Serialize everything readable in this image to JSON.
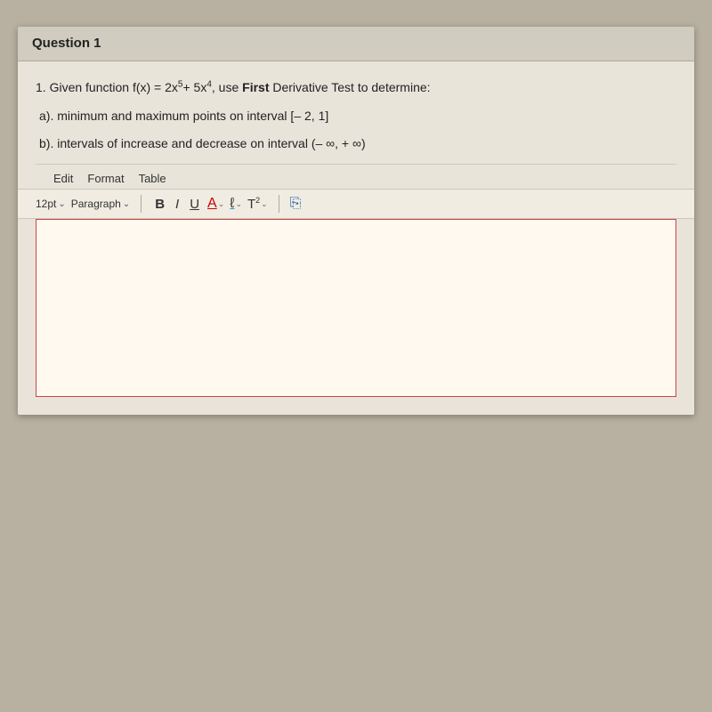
{
  "header": {
    "title": "Question 1"
  },
  "question": {
    "main_text_1": "1. Given function f(x) = 2x",
    "main_exp_1": "5",
    "main_text_2": "+ 5x",
    "main_exp_2": "4",
    "main_text_3": ", use ",
    "main_bold": "First",
    "main_text_4": " Derivative Test to determine:",
    "sub_a": "a). minimum and maximum points on interval [– 2, 1]",
    "sub_b": "b). intervals of increase and decrease on interval (– ∞, + ∞)"
  },
  "menu": {
    "edit": "Edit",
    "format": "Format",
    "table": "Table"
  },
  "toolbar": {
    "font_size": "12pt",
    "font_size_chevron": "∨",
    "paragraph": "Paragraph",
    "paragraph_chevron": "∨",
    "bold": "B",
    "italic": "I",
    "underline": "U",
    "font_color": "A",
    "highlight": "ℓ",
    "superscript_label": "T",
    "superscript_exp": "2"
  }
}
